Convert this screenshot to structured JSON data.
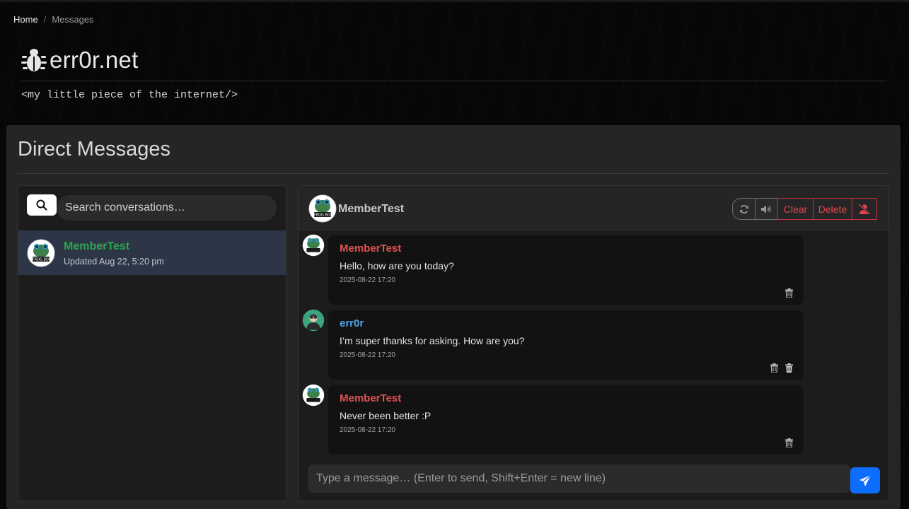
{
  "breadcrumb": {
    "home": "Home",
    "separator": "/",
    "current": "Messages"
  },
  "site": {
    "title": "err0r.net",
    "tagline": "<my little piece of the internet/>",
    "logo_icon": "bug-icon"
  },
  "page": {
    "title": "Direct Messages"
  },
  "sidebar": {
    "search_placeholder": "Search conversations…",
    "conversations": [
      {
        "name": "MemberTest",
        "updated": "Updated Aug 22, 5:20 pm",
        "avatar": "frog-boi-avatar",
        "avatar_text": "FROG BOI"
      }
    ]
  },
  "chat": {
    "recipient": "MemberTest",
    "buttons": {
      "refresh": "refresh-icon",
      "sound": "volume-icon",
      "clear": "Clear",
      "delete": "Delete",
      "block": "block-user-icon"
    },
    "messages": [
      {
        "author": "MemberTest",
        "text": "Hello, how are you today?",
        "time": "2025-08-22 17:20",
        "author_color": "#e05252",
        "avatar": "frog-boi-avatar"
      },
      {
        "author": "err0r",
        "text": "I’m super thanks for asking. How are you?",
        "time": "2025-08-22 17:20",
        "author_color": "#4aa3e8",
        "avatar": "err0r-avatar"
      },
      {
        "author": "MemberTest",
        "text": "Never been better :P",
        "time": "2025-08-22 17:20",
        "author_color": "#e05252",
        "avatar": "frog-boi-avatar"
      }
    ],
    "input_placeholder": "Type a message… (Enter to send, Shift+Enter = new line)"
  },
  "colors": {
    "accent_blue": "#0d6efd",
    "danger": "#dc3545",
    "online_green": "#2fa44f",
    "selected_row": "#2c3647"
  }
}
